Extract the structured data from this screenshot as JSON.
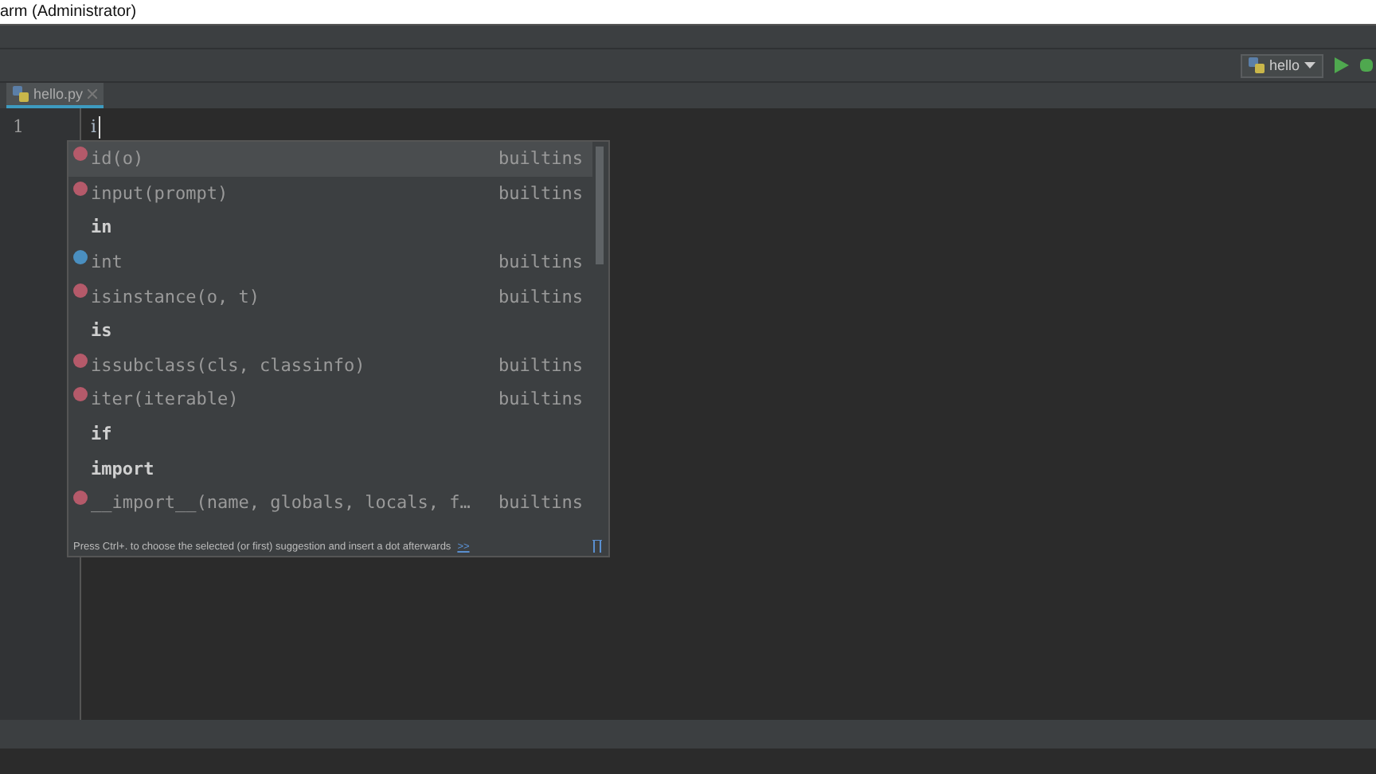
{
  "window": {
    "title": "arm (Administrator)"
  },
  "run_config": {
    "label": "hello"
  },
  "tabs": [
    {
      "label": "hello.py",
      "selected": true
    }
  ],
  "editor": {
    "line_numbers": [
      "1"
    ],
    "lines": [
      "i"
    ]
  },
  "completion": {
    "items": [
      {
        "kind": "function",
        "text": "id(o)",
        "source": "builtins",
        "selected": true
      },
      {
        "kind": "function",
        "text": "input(prompt)",
        "source": "builtins",
        "selected": false
      },
      {
        "kind": "keyword",
        "text": "in",
        "selected": false
      },
      {
        "kind": "class",
        "text": "int",
        "source": "builtins",
        "selected": false
      },
      {
        "kind": "function",
        "text": "isinstance(o, t)",
        "source": "builtins",
        "selected": false
      },
      {
        "kind": "keyword",
        "text": "is",
        "selected": false
      },
      {
        "kind": "function",
        "text": "issubclass(cls, classinfo)",
        "source": "builtins",
        "selected": false
      },
      {
        "kind": "function",
        "text": "iter(iterable)",
        "source": "builtins",
        "selected": false
      },
      {
        "kind": "keyword",
        "text": "if",
        "selected": false
      },
      {
        "kind": "keyword",
        "text": "import",
        "selected": false
      },
      {
        "kind": "function",
        "text": "__import__(name, globals, locals, f…",
        "source": "builtins",
        "selected": false
      }
    ],
    "hint": "Press Ctrl+. to choose the selected (or first) suggestion and insert a dot afterwards",
    "hint_link": ">>"
  }
}
